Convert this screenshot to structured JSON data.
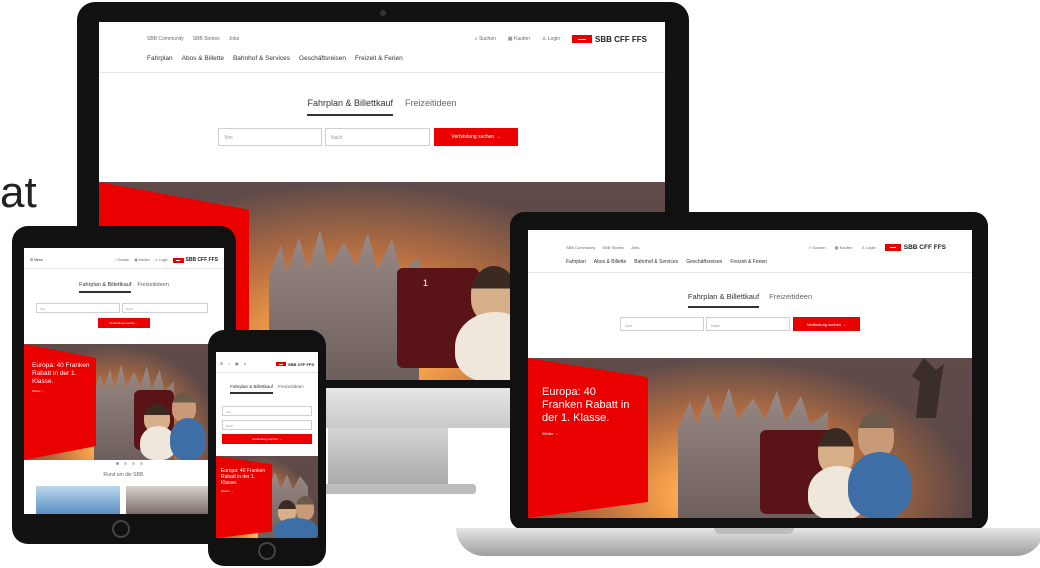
{
  "slide_fragment": "at",
  "site": {
    "toplinks": [
      "SBB Community",
      "SBB Stories",
      "Jobs"
    ],
    "nav": [
      "Fahrplan",
      "Abos & Billette",
      "Bahnhof & Services",
      "Geschäftsreisen",
      "Freizeit & Ferien"
    ],
    "utilities": {
      "search": "Suchen",
      "cart": "Kaufen",
      "login": "Login"
    },
    "menu": "Menu",
    "logo": "SBB CFF FFS",
    "tabs": [
      "Fahrplan & Billettkauf",
      "Freizeitideen"
    ],
    "from_placeholder": "Von",
    "to_placeholder": "Nach",
    "search_button": "Verbindung suchen →",
    "promo_title": "Europa: 40 Franken Rabatt in der 1. Klasse.",
    "promo_link": "Weiter →",
    "seat_number": "1",
    "section_title": "Rund um die SBB."
  },
  "colors": {
    "brand_red": "#eb0000"
  }
}
